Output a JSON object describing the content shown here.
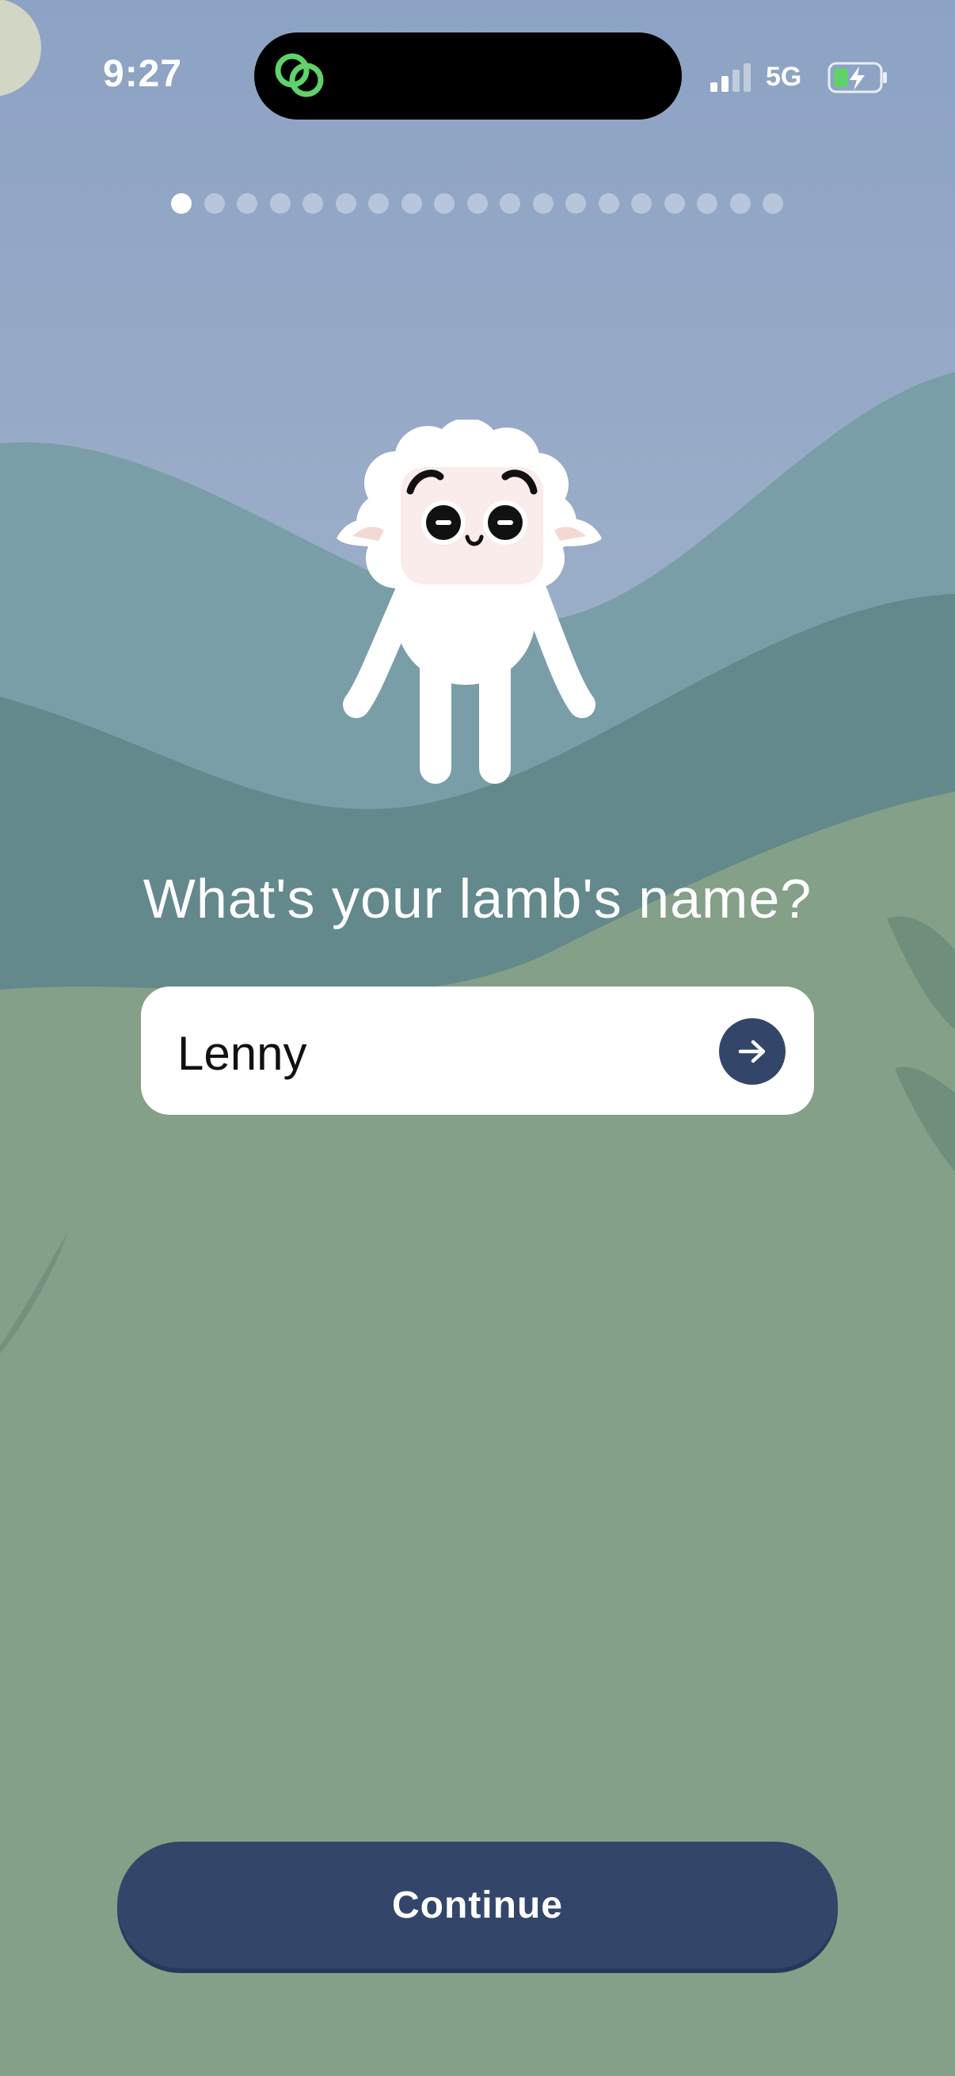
{
  "status_bar": {
    "time": "9:27",
    "network": "5G",
    "icons": [
      "app-link-icon",
      "signal-icon",
      "battery-charging-icon"
    ]
  },
  "onboarding": {
    "total_steps": 19,
    "current_step": 1,
    "question": "What's your lamb's name?",
    "name_value": "Lenny",
    "submit_icon": "arrow-right-icon",
    "continue_label": "Continue"
  },
  "colors": {
    "accent": "#33466a",
    "background_grass": "#84a088",
    "sky": "#9aadc4"
  }
}
